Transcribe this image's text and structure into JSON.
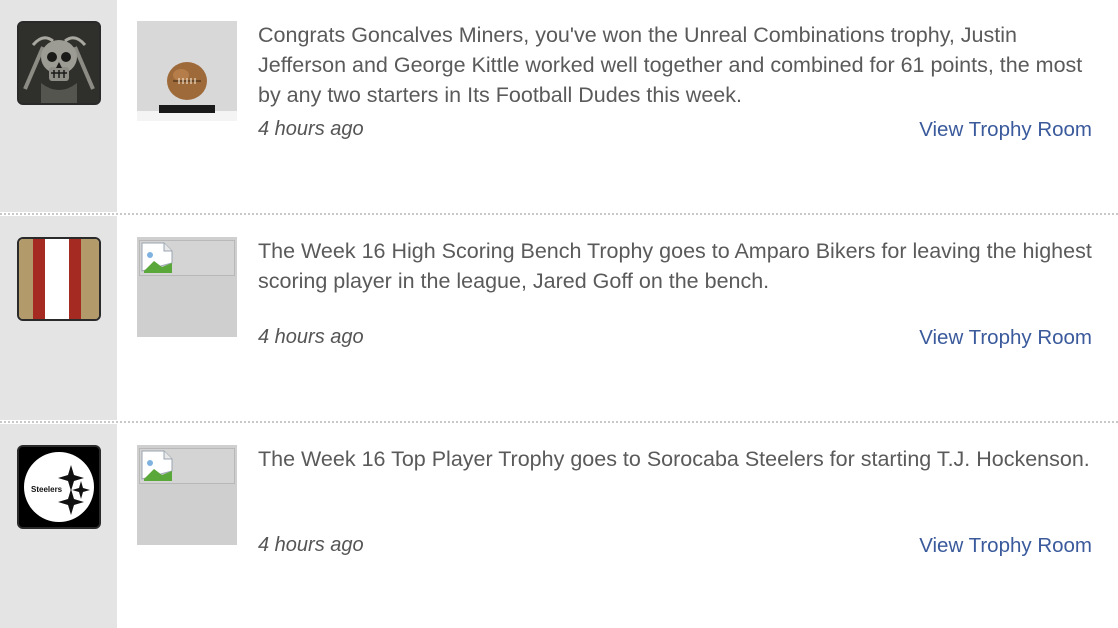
{
  "feed": {
    "items": [
      {
        "avatar_icon": "skull-team-logo-icon",
        "trophy_icon": "football-trophy-icon",
        "message": "Congrats Goncalves Miners, you've won the Unreal Combinations trophy, Justin Jefferson and George Kittle worked well together and combined for 61 points, the most by any two starters in Its Football Dudes this week.",
        "time": "4 hours ago",
        "link": "View Trophy Room"
      },
      {
        "avatar_icon": "striped-team-logo-icon",
        "trophy_icon": "broken-image-icon",
        "message": "The Week 16 High Scoring Bench Trophy goes to Amparo Bikers for leaving the highest scoring player in the league, Jared Goff on the bench.",
        "time": "4 hours ago",
        "link": "View Trophy Room"
      },
      {
        "avatar_icon": "steelers-logo-icon",
        "avatar_text": "Steelers",
        "trophy_icon": "broken-image-icon",
        "message": "The Week 16 Top Player Trophy goes to Sorocaba Steelers for starting T.J. Hockenson.",
        "time": "4 hours ago",
        "link": "View Trophy Room"
      }
    ]
  },
  "colors": {
    "link": "#3a5a9c",
    "text": "#5a5a5a",
    "sidebar": "#e4e4e4",
    "stripe_red": "#a52a22",
    "stripe_gold": "#b39a6a"
  }
}
